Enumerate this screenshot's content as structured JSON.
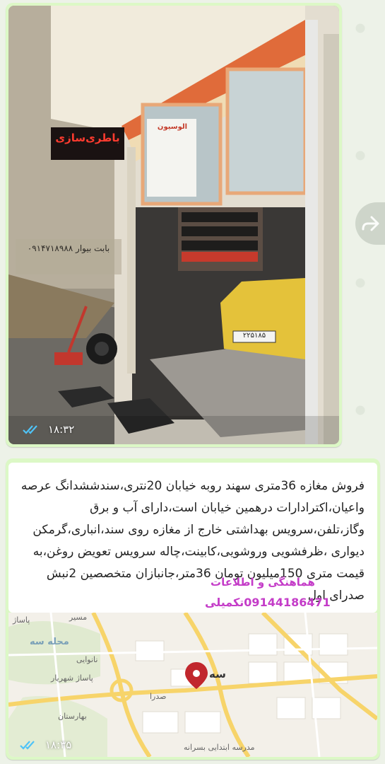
{
  "photo_message": {
    "time": "۱۸:۳۲",
    "shop_sign": "باطری‌سازی",
    "poster_text": "الوسیون",
    "wall_text": "بابت بیوار ۰۹۱۴۷۱۸۹۸۸",
    "plate_text": "۲۲۵۱۸۵"
  },
  "text_message": {
    "body": "فروش مغازه 36متری سهند روبه خیابان 20نتری،سندششدانگ عرصه واعیان،اکترادارات درهمین خیابان است،دارای آب و برق وگاز،تلفن،سرویس بهداشتی خارج از مغازه روی سند،انباری،گرمکن دیواری ،ظرفشویی وروشویی،کابینت،چاله سرویس تعویض روغن،به قیمت متری 150میلیون تومان 36متر،جانبازان متخصصین 2نبش صدرای اول",
    "contact_label": "هماهنگی و اطلاعات",
    "contact_phone": "09144186471تکمیلی",
    "time": "۱۸:۳۵"
  },
  "map": {
    "labels": {
      "district": "محله سه",
      "school": "نانوایی",
      "passage": "پاساژ شهریار",
      "hospital": "بهارستان",
      "place_short": "سه",
      "road1": "صدرا",
      "road2": "مدرسه ابتدایی بسرانه",
      "top1": "پاساژ",
      "top2": "مسیر"
    }
  },
  "icons": {
    "forward": "forward-icon",
    "read_ticks": "double-check-icon",
    "map_pin": "map-pin-icon"
  },
  "colors": {
    "bubble": "#dcf8c6",
    "tick": "#4fc3f7",
    "contact": "#c43cc8",
    "pin": "#c1272d"
  }
}
